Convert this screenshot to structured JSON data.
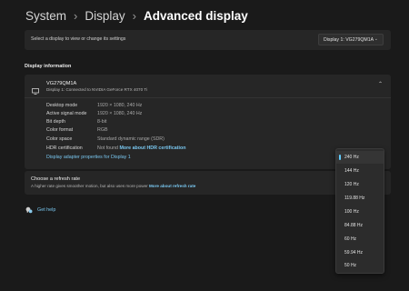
{
  "breadcrumb": {
    "items": [
      "System",
      "Display",
      "Advanced display"
    ]
  },
  "display_select": {
    "label": "Select a display to view or change its settings",
    "value": "Display 1: VG279QM1A"
  },
  "display_info": {
    "section_title": "Display information",
    "monitor_name": "VG279QM1A",
    "monitor_subtitle": "Display 1: Connected to NVIDIA GeForce RTX 4070 Ti",
    "rows": [
      {
        "key": "Desktop mode",
        "value": "1920 × 1080, 240 Hz"
      },
      {
        "key": "Active signal mode",
        "value": "1920 × 1080, 240 Hz"
      },
      {
        "key": "Bit depth",
        "value": "8-bit"
      },
      {
        "key": "Color format",
        "value": "RGB"
      },
      {
        "key": "Color space",
        "value": "Standard dynamic range (SDR)"
      }
    ],
    "hdr": {
      "key": "HDR certification",
      "value": "Not found",
      "link": "More about HDR certification"
    },
    "adapter_link": "Display adapter properties for Display 1"
  },
  "refresh": {
    "title": "Choose a refresh rate",
    "description": "A higher rate gives smoother motion, but also uses more power",
    "link": "More about refresh rate",
    "options": [
      "240 Hz",
      "144 Hz",
      "120 Hz",
      "119.88 Hz",
      "100 Hz",
      "84.88 Hz",
      "60 Hz",
      "59.94 Hz",
      "50 Hz"
    ],
    "selected_index": 0
  },
  "help": {
    "label": "Get help"
  },
  "colors": {
    "accent": "#60cdff",
    "link": "#79c7f0",
    "background": "#1a1a1a",
    "card": "#262626"
  },
  "icons": {
    "monitor": "monitor-icon",
    "help": "help-icon",
    "chevron": "chevron-down-icon",
    "collapse": "chevron-up-icon"
  }
}
